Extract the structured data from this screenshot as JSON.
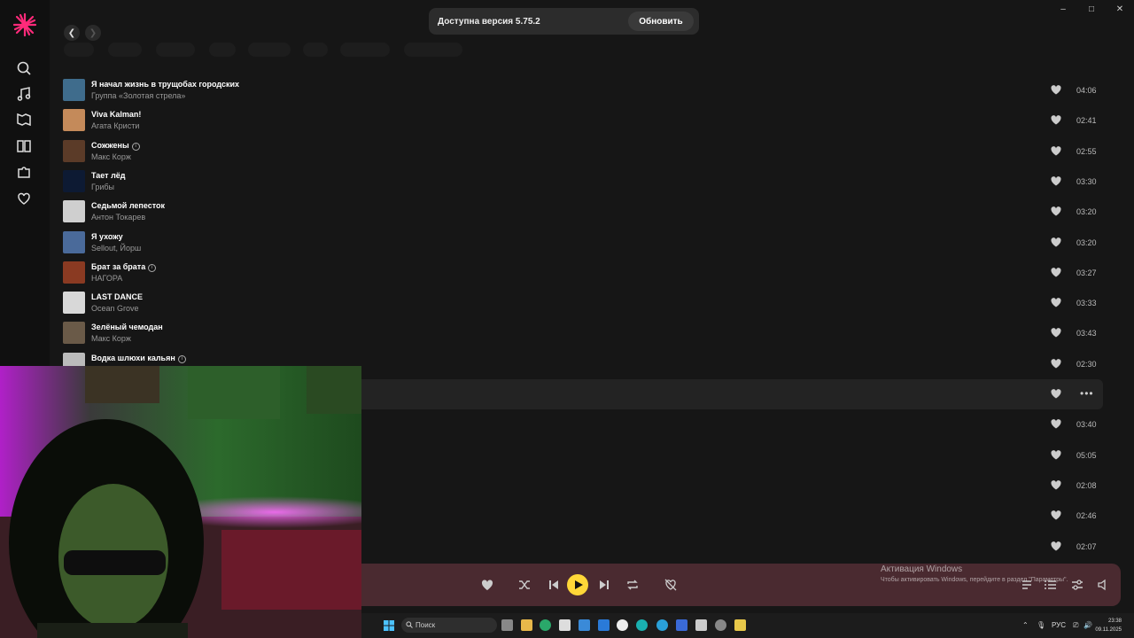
{
  "window": {
    "minimize": "–",
    "maximize": "□",
    "close": "✕"
  },
  "update": {
    "text": "Доступна версия 5.75.2",
    "button": "Обновить"
  },
  "tracks": [
    {
      "title": "Я начал жизнь в трущобах городских",
      "artist": "Группа «Золотая стрела»",
      "duration": "04:06",
      "explicit": false,
      "cover": "#3f6c8c"
    },
    {
      "title": "Viva Kalman!",
      "artist": "Агата Кристи",
      "duration": "02:41",
      "explicit": false,
      "cover": "#c48a5a"
    },
    {
      "title": "Сожжены",
      "artist": "Макс Корж",
      "duration": "02:55",
      "explicit": true,
      "cover": "#5b3b28"
    },
    {
      "title": "Тает лёд",
      "artist": "Грибы",
      "duration": "03:30",
      "explicit": false,
      "cover": "#0d1a33"
    },
    {
      "title": "Седьмой лепесток",
      "artist": "Антон Токарев",
      "duration": "03:20",
      "explicit": false,
      "cover": "#cfcfcf"
    },
    {
      "title": "Я ухожу",
      "artist": "Sellout, Йорш",
      "duration": "03:20",
      "explicit": false,
      "cover": "#4a6a9a"
    },
    {
      "title": "Брат за брата",
      "artist": "НАГОРА",
      "duration": "03:27",
      "explicit": true,
      "cover": "#8a3a22"
    },
    {
      "title": "LAST DANCE",
      "artist": "Ocean Grove",
      "duration": "03:33",
      "explicit": false,
      "cover": "#d8d8d8"
    },
    {
      "title": "Зелёный чемодан",
      "artist": "Макс Корж",
      "duration": "03:43",
      "explicit": false,
      "cover": "#6a5a48"
    },
    {
      "title": "Водка шлюхи кальян",
      "artist": "",
      "duration": "02:30",
      "explicit": true,
      "cover": "#bbbbbb"
    },
    {
      "title": "",
      "artist": "",
      "duration": "",
      "explicit": false,
      "cover": ""
    },
    {
      "title": "",
      "artist": "",
      "duration": "03:40",
      "explicit": false,
      "cover": ""
    },
    {
      "title": "",
      "artist": "",
      "duration": "05:05",
      "explicit": false,
      "cover": ""
    },
    {
      "title": "",
      "artist": "",
      "duration": "02:08",
      "explicit": false,
      "cover": ""
    },
    {
      "title": "",
      "artist": "",
      "duration": "02:46",
      "explicit": false,
      "cover": ""
    },
    {
      "title": "",
      "artist": "",
      "duration": "02:07",
      "explicit": false,
      "cover": ""
    }
  ],
  "more_label": "•••",
  "activation": {
    "title": "Активация Windows",
    "subtitle": "Чтобы активировать Windows, перейдите в раздел \"Параметры\"."
  },
  "taskbar": {
    "search_placeholder": "Поиск",
    "lang": "РУС",
    "time": "23:38",
    "date": "09.11.2025"
  },
  "colors": {
    "accent": "#ffd738",
    "player_bg": "#4a2a30"
  }
}
